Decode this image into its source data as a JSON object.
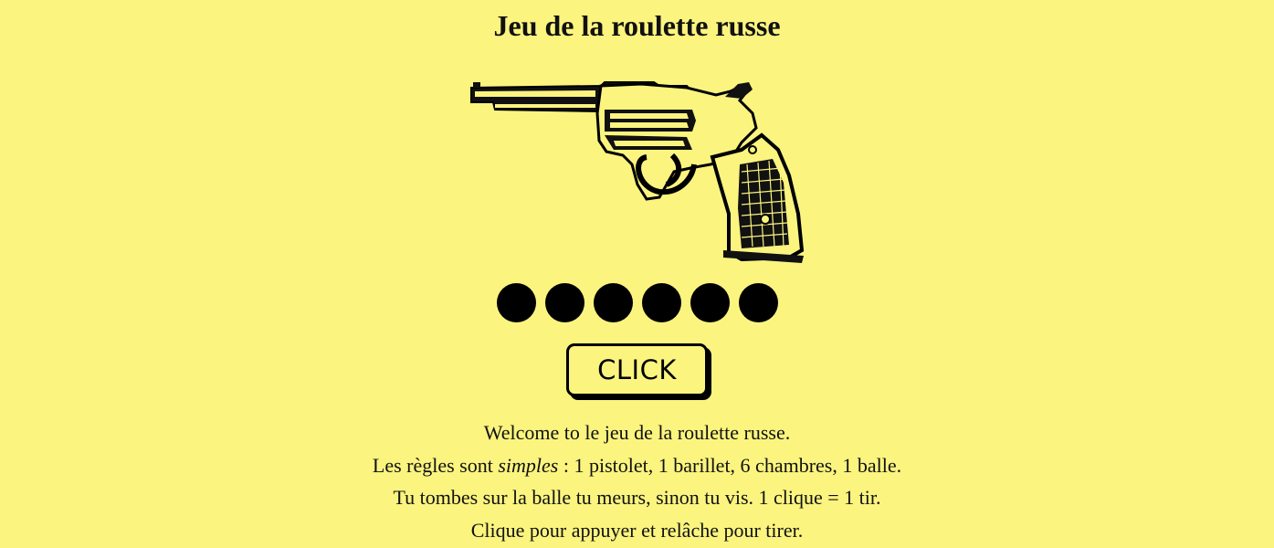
{
  "header": {
    "title": "Jeu de la roulette russe"
  },
  "gun": {
    "icon": "revolver-icon"
  },
  "barrel": {
    "chambers": [
      "loaded",
      "loaded",
      "loaded",
      "loaded",
      "loaded",
      "loaded"
    ],
    "chamber_color": "#000000"
  },
  "action": {
    "button_label": "CLICK"
  },
  "rules": {
    "line1": "Welcome to le jeu de la roulette russe.",
    "line2_before": "Les règles sont ",
    "line2_emphasis": "simples",
    "line2_after": " : 1 pistolet, 1 barillet, 6 chambres, 1 balle.",
    "line3": "Tu tombes sur la balle tu meurs, sinon tu vis. 1 clique = 1 tir.",
    "line4": "Clique pour appuyer et relâche pour tirer."
  },
  "colors": {
    "background": "#fbf47f",
    "ink": "#111111"
  }
}
